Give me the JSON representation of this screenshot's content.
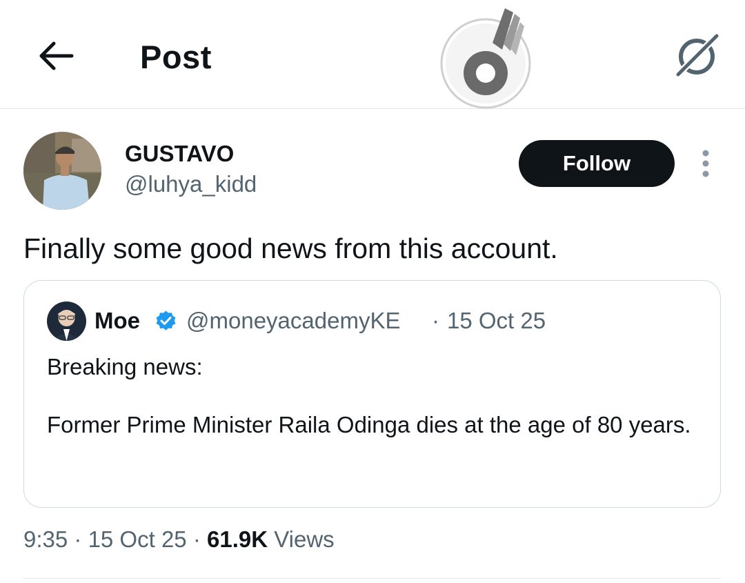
{
  "header": {
    "title": "Post",
    "back_icon": "arrow-left-icon",
    "grok_icon": "grok-icon",
    "logo_icon": "watermark-logo-icon"
  },
  "post": {
    "author": {
      "name": "GUSTAVO",
      "handle": "@luhya_kidd"
    },
    "follow_label": "Follow",
    "more_icon": "more-vertical-icon",
    "text": "Finally some good news from this account."
  },
  "quote": {
    "name": "Moe",
    "verified_icon": "verified-badge-icon",
    "handle": "@moneyacademyKE",
    "separator": "·",
    "date": "15 Oct 25",
    "body": "Breaking news:\n\nFormer Prime Minister Raila Odinga dies at the age of 80 years."
  },
  "meta": {
    "time": "9:35",
    "sep1": " · ",
    "date": "15 Oct 25",
    "sep2": " · ",
    "views_count": "61.9K",
    "views_label": " Views"
  },
  "colors": {
    "text": "#0f1419",
    "secondary": "#536471",
    "verified": "#1d9bf0",
    "border": "#cfd9de"
  }
}
